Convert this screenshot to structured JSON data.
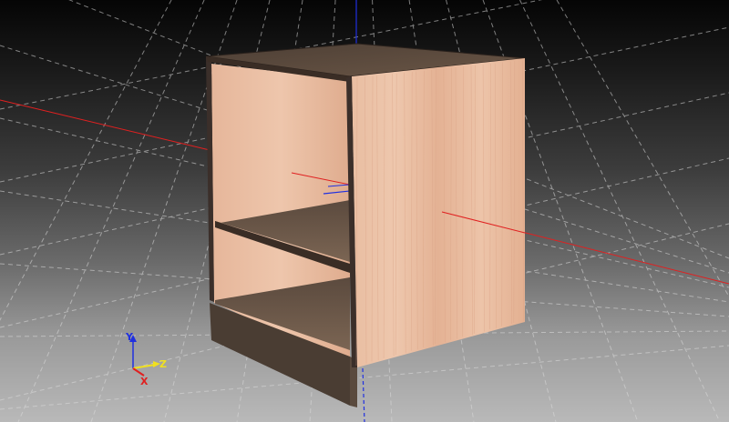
{
  "viewport": {
    "background_top": "#050505",
    "background_bottom": "#b9b9b9",
    "grid_color": "#dcdcdc"
  },
  "axes": {
    "x_label": "X",
    "y_label": "Y",
    "z_label": "Z",
    "x_color": "#e02020",
    "y_color": "#2030e0",
    "z_color": "#f0e020"
  },
  "cabinet": {
    "panel_color": "#e8b89a",
    "panel_grain_color": "#d9a184",
    "edge_color": "#3b2f2a",
    "shelf_color": "#6a5647",
    "plinth_color": "#4a3d33"
  }
}
